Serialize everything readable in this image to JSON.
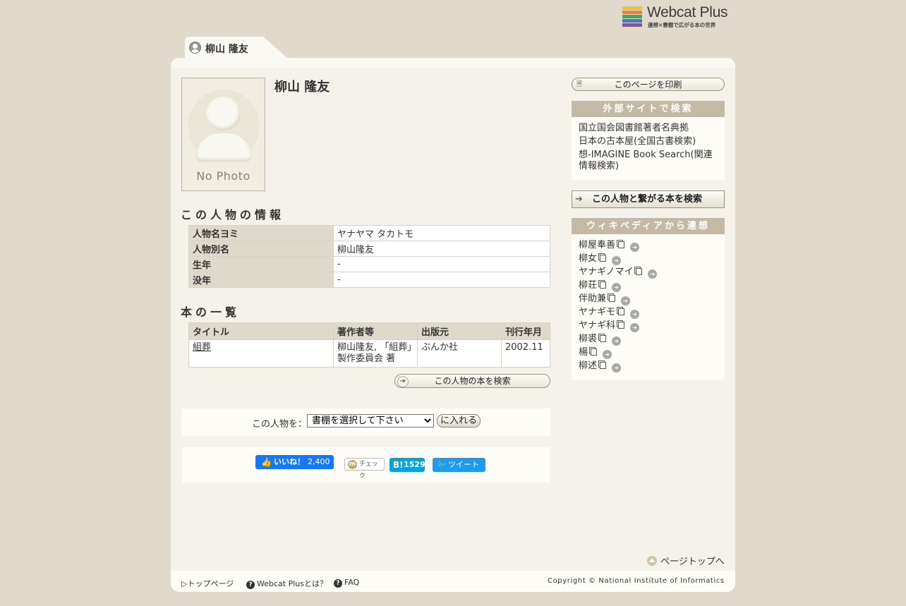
{
  "logo": {
    "name": "Webcat Plus",
    "tagline": "連想×書棚で広がる本の世界",
    "bar_colors": [
      "#f2c230",
      "#e8872d",
      "#4aa35a",
      "#3b7cc4",
      "#8a4fa0"
    ]
  },
  "tab": {
    "label": "柳山 隆友"
  },
  "person": {
    "name": "柳山 隆友",
    "photo_text": "No Photo"
  },
  "info_section": {
    "heading": "この人物の情報",
    "rows": [
      {
        "key": "人物名ヨミ",
        "value": "ヤナヤマ タカトモ"
      },
      {
        "key": "人物別名",
        "value": "柳山隆友"
      },
      {
        "key": "生年",
        "value": "-"
      },
      {
        "key": "没年",
        "value": "-"
      }
    ]
  },
  "books_section": {
    "heading": "本の一覧",
    "columns": [
      "タイトル",
      "著作者等",
      "出版元",
      "刊行年月"
    ],
    "rows": [
      {
        "title": "組葬",
        "authors": "柳山隆友, 「組葬」製作委員会 著",
        "publisher": "ぶんか社",
        "date": "2002.11"
      }
    ],
    "search_button": "この人物の本を検索"
  },
  "shelf": {
    "label": "この人物を：",
    "select_value": "書棚を選択して下さい",
    "add_button": "に入れる"
  },
  "social": {
    "fb_label": "いいね！",
    "fb_count": "2,400",
    "mixi_label": "チェック",
    "hatena_count": "1529",
    "tweet_label": "ツイート"
  },
  "sidebar": {
    "print_button": "このページを印刷",
    "external_heading": "外部サイトで検索",
    "external_links": [
      "国立国会図書館著者名典拠",
      "日本の古本屋(全国古書検索)",
      "想-IMAGINE Book Search(関連情報検索)"
    ],
    "connect_button": "この人物と繋がる本を検索",
    "wiki_heading": "ウィキペディアから連想",
    "wiki_items": [
      "柳屋奉善",
      "柳女",
      "ヤナギノマイ",
      "柳荘",
      "伴助兼",
      "ヤナギモ",
      "ヤナギ科",
      "柳裘",
      "楊",
      "柳述"
    ]
  },
  "page_top": "ページトップへ",
  "footer": {
    "top_page": "トップページ",
    "about": "Webcat Plusとは？",
    "faq": "FAQ",
    "copyright": "Copyright © National Institute of Informatics"
  }
}
